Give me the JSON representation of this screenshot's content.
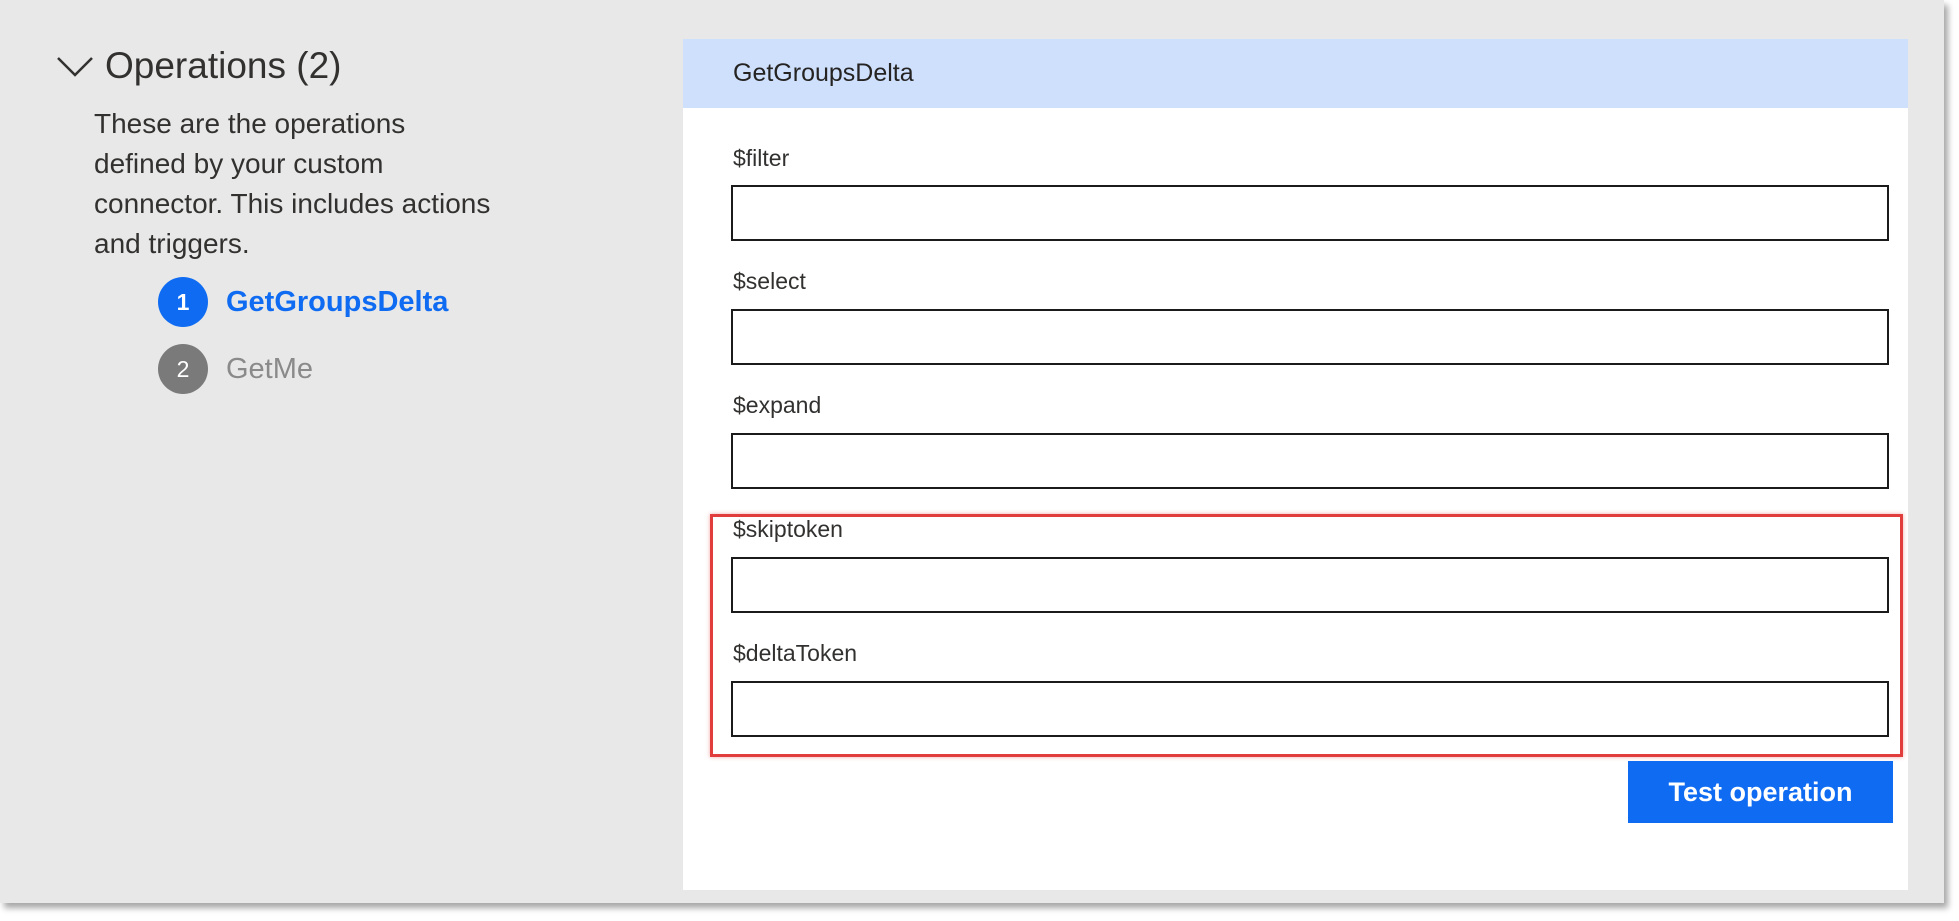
{
  "operations": {
    "title": "Operations (2)",
    "description": "These are the operations defined by your custom connector. This includes actions and triggers.",
    "items": [
      {
        "number": "1",
        "name": "GetGroupsDelta",
        "selected": true
      },
      {
        "number": "2",
        "name": "GetMe",
        "selected": false
      }
    ]
  },
  "panel": {
    "title": "GetGroupsDelta",
    "fields": [
      {
        "label": "$filter",
        "value": ""
      },
      {
        "label": "$select",
        "value": ""
      },
      {
        "label": "$expand",
        "value": ""
      },
      {
        "label": "$skiptoken",
        "value": ""
      },
      {
        "label": "$deltaToken",
        "value": ""
      }
    ],
    "test_button_label": "Test operation"
  },
  "colors": {
    "accent": "#0f6cf2",
    "panel_header": "#cfe0fc",
    "highlight": "#e13d3d",
    "inactive": "#7a7a7a"
  },
  "icons": {
    "collapse": "chevron-down-icon"
  }
}
